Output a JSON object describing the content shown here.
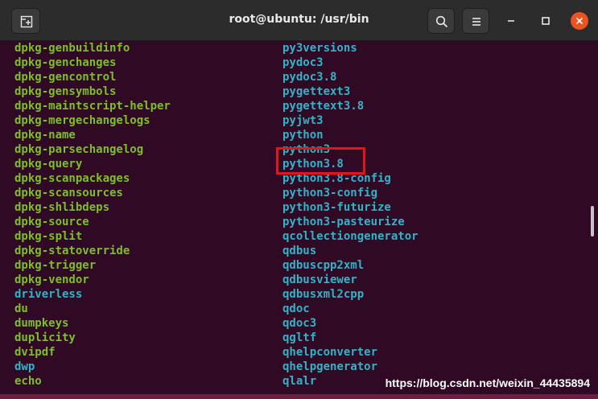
{
  "window": {
    "title": "root@ubuntu: /usr/bin",
    "icons": {
      "new_tab": "new-tab-icon",
      "search": "search-icon",
      "menu": "hamburger-menu-icon",
      "minimize": "minimize-icon",
      "maximize": "maximize-icon",
      "close": "close-icon"
    }
  },
  "colors": {
    "background": "#300a24",
    "executable": "#7dbf2a",
    "symlink": "#34b3c8",
    "highlight": "#e2141c",
    "close_button": "#e95420"
  },
  "terminal": {
    "left_column": [
      "dpkg-genbuildinfo",
      "dpkg-genchanges",
      "dpkg-gencontrol",
      "dpkg-gensymbols",
      "dpkg-maintscript-helper",
      "dpkg-mergechangelogs",
      "dpkg-name",
      "dpkg-parsechangelog",
      "dpkg-query",
      "dpkg-scanpackages",
      "dpkg-scansources",
      "dpkg-shlibdeps",
      "dpkg-source",
      "dpkg-split",
      "dpkg-statoverride",
      "dpkg-trigger",
      "dpkg-vendor",
      "driverless",
      "du",
      "dumpkeys",
      "duplicity",
      "dvipdf",
      "dwp",
      "echo"
    ],
    "left_column_types": [
      "exe",
      "exe",
      "exe",
      "exe",
      "exe",
      "exe",
      "exe",
      "exe",
      "exe",
      "exe",
      "exe",
      "exe",
      "exe",
      "exe",
      "exe",
      "exe",
      "exe",
      "link",
      "exe",
      "exe",
      "exe",
      "exe",
      "link",
      "exe"
    ],
    "right_column": [
      "py3versions",
      "pydoc3",
      "pydoc3.8",
      "pygettext3",
      "pygettext3.8",
      "pyjwt3",
      "python",
      "python3",
      "python3.8",
      "python3.8-config",
      "python3-config",
      "python3-futurize",
      "python3-pasteurize",
      "qcollectiongenerator",
      "qdbus",
      "qdbuscpp2xml",
      "qdbusviewer",
      "qdbusxml2cpp",
      "qdoc",
      "qdoc3",
      "qgltf",
      "qhelpconverter",
      "qhelpgenerator",
      "qlalr"
    ],
    "right_column_types": [
      "link",
      "link",
      "link",
      "link",
      "link",
      "link",
      "link",
      "link",
      "link",
      "link",
      "link",
      "link",
      "link",
      "link",
      "link",
      "link",
      "link",
      "link",
      "link",
      "link",
      "link",
      "link",
      "link",
      "link"
    ],
    "highlighted_entry": "python3.8"
  },
  "watermark": "https://blog.csdn.net/weixin_44435894"
}
